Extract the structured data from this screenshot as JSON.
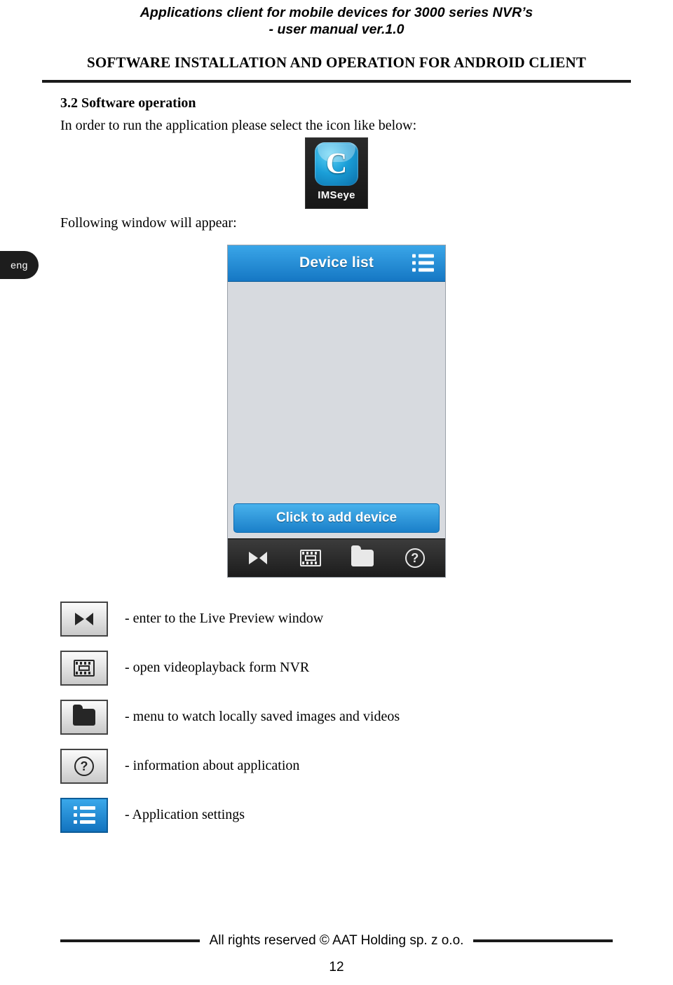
{
  "header": {
    "line1": "Applications client for mobile devices for 3000 series NVR’s",
    "line2": "- user manual ver.1.0",
    "section_title": "SOFTWARE INSTALLATION AND OPERATION FOR ANDROID CLIENT"
  },
  "side_tab": {
    "label": "eng"
  },
  "body": {
    "heading": "3.2 Software operation",
    "paragraph1": "In order to run the application please select the icon like below:",
    "paragraph2": "Following window will appear:"
  },
  "app_icon": {
    "letter": "C",
    "label": "IMSeye"
  },
  "phone": {
    "title": "Device list",
    "menu_icon": "list-menu-icon",
    "add_button": "Click to add device",
    "toolbar": [
      {
        "icon": "live-preview-icon"
      },
      {
        "icon": "playback-film-icon"
      },
      {
        "icon": "folder-icon"
      },
      {
        "icon": "question-help-icon"
      }
    ]
  },
  "legend": [
    {
      "icon": "live-preview-icon",
      "text": "- enter to the Live Preview window"
    },
    {
      "icon": "playback-film-icon",
      "text": "- open videoplayback form NVR"
    },
    {
      "icon": "folder-icon",
      "text": "- menu to watch locally saved images and videos"
    },
    {
      "icon": "question-help-icon",
      "text": "- information about application"
    },
    {
      "icon": "list-menu-icon",
      "text": "- Application settings"
    }
  ],
  "footer": {
    "text": "All rights reserved © AAT Holding sp. z o.o.",
    "page": "12"
  },
  "colors": {
    "accent_blue": "#1a7fc9",
    "title_blue": "#2a9ae0",
    "dark": "#1b1b1b"
  }
}
